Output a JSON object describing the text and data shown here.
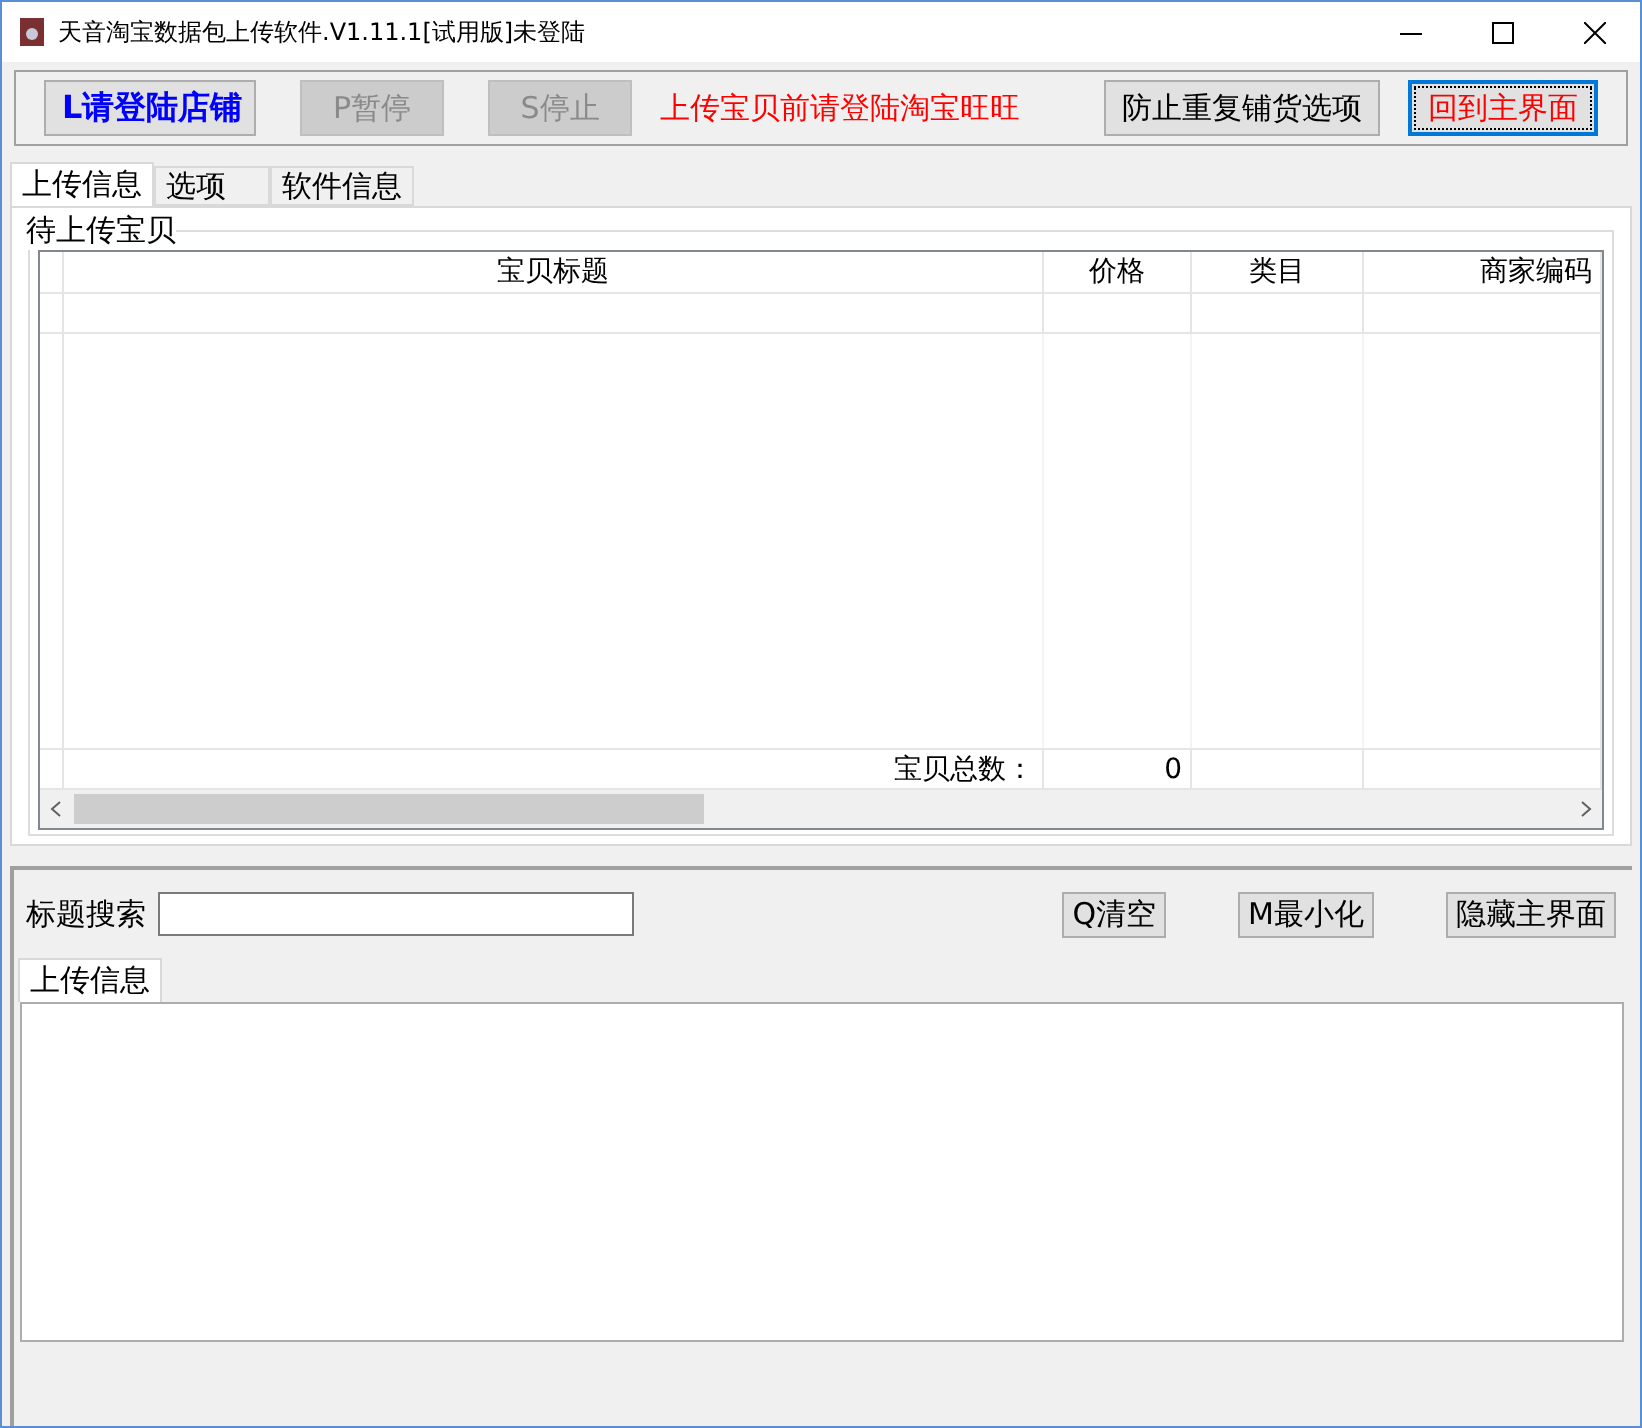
{
  "window": {
    "title": "天音淘宝数据包上传软件.V1.11.1[试用版]未登陆"
  },
  "toolbar": {
    "buttons": [
      {
        "label": "L请登陆店铺",
        "disabled": false,
        "kind": "login"
      },
      {
        "label": "P暂停",
        "disabled": true,
        "kind": "plain"
      },
      {
        "label": "S停止",
        "disabled": true,
        "kind": "plain"
      }
    ],
    "notice": "上传宝贝前请登陆淘宝旺旺",
    "right_buttons": [
      {
        "label": "防止重复铺货选项",
        "focused": false
      },
      {
        "label": "回到主界面",
        "focused": true
      }
    ]
  },
  "tabs": [
    {
      "label": "上传信息",
      "selected": true
    },
    {
      "label": "选项",
      "selected": false
    },
    {
      "label": "软件信息",
      "selected": false
    }
  ],
  "group": {
    "title": "待上传宝贝"
  },
  "table": {
    "columns": [
      "宝贝标题",
      "价格",
      "类目",
      "商家编码"
    ],
    "footer": {
      "label": "宝贝总数：",
      "count": "0"
    }
  },
  "search": {
    "label": "标题搜索",
    "buttons": [
      "Q清空",
      "M最小化",
      "隐藏主界面"
    ]
  },
  "log": {
    "tabs": [
      {
        "label": "上传信息",
        "selected": true
      }
    ]
  }
}
